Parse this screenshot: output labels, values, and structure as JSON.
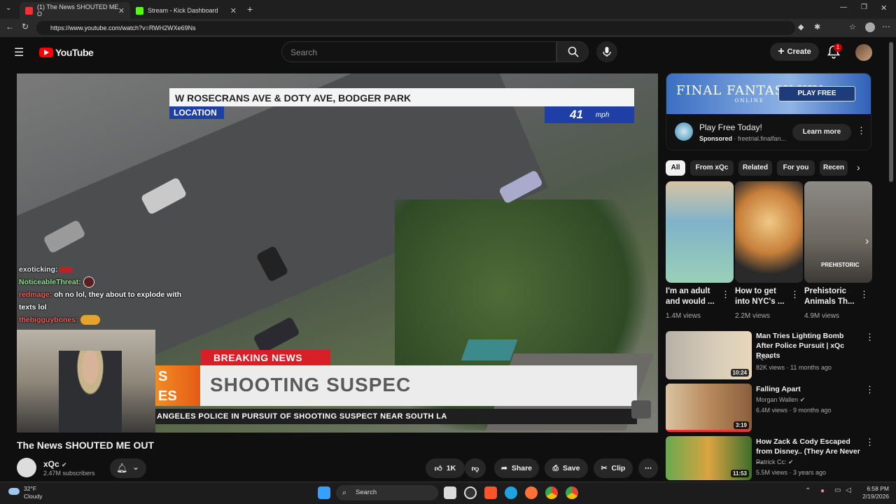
{
  "browser": {
    "tabs": [
      {
        "label": "(1) The News SHOUTED ME O"
      },
      {
        "label": "Stream - Kick Dashboard"
      }
    ],
    "url": "https://www.youtube.com/watch?v=RWH2WXe69Ns"
  },
  "header": {
    "logo_text": "YouTube",
    "search_placeholder": "Search",
    "create_label": "Create",
    "notification_count": "1"
  },
  "video": {
    "overlay": {
      "location_text": "W ROSECRANS AVE & DOTY AVE, BODGER PARK",
      "location_label": "LOCATION",
      "speed_value": "41",
      "speed_unit": "mph",
      "breaking_label": "BREAKING NEWS",
      "headline_side": "S\nES",
      "headline": "SHOOTING SUSPEC",
      "ticker": "ANGELES POLICE IN PURSUIT OF SHOOTING SUSPECT NEAR SOUTH LA"
    },
    "chat": [
      {
        "user": "exoticking:",
        "msg": ""
      },
      {
        "user": "NoticeableThreat:",
        "msg": ""
      },
      {
        "user": "redmage:",
        "msg": "oh no lol, they about to explode with texts lol"
      },
      {
        "user": "thebigguybones:",
        "msg": ""
      }
    ],
    "title": "The News SHOUTED ME OUT",
    "channel": "xQc",
    "subscribers": "2.47M subscribers",
    "likes": "1K",
    "share_label": "Share",
    "save_label": "Save",
    "clip_label": "Clip"
  },
  "ad": {
    "banner_logo": "FINAL FANTASY XIV",
    "banner_sub": "ONLINE",
    "banner_button": "PLAY FREE",
    "title": "Play Free Today!",
    "sponsored": "Sponsored",
    "domain": "· freetrial.finalfan...",
    "learn_more": "Learn more"
  },
  "chips": [
    "All",
    "From xQc",
    "Related",
    "For you",
    "Recen"
  ],
  "shorts": [
    {
      "title": "I'm an adult and would ...",
      "views": "1.4M views",
      "thumb_text": ""
    },
    {
      "title": "How to get into NYC's ...",
      "views": "2.2M views",
      "thumb_text": ""
    },
    {
      "title": "Prehistoric Animals Th...",
      "views": "4.9M views",
      "thumb_text": "PREHISTORIC"
    }
  ],
  "recommendations": [
    {
      "title": "Man Tries Lighting Bomb After Police Pursuit | xQc Reacts",
      "channel": "xQc",
      "meta": "82K views · 11 months ago",
      "duration": "10:24"
    },
    {
      "title": "Falling Apart",
      "channel": "Morgan Wallen",
      "meta": "6.4M views · 9 months ago",
      "duration": "3:19"
    },
    {
      "title": "How Zack & Cody Escaped from Disney.. (They Are Never ...",
      "channel": "Patrick Cc:",
      "meta": "5.5M views · 3 years ago",
      "duration": "11:53"
    }
  ],
  "taskbar": {
    "temp": "32°F",
    "condition": "Cloudy",
    "search_label": "Search",
    "time": "6:58 PM",
    "date": "2/19/2026"
  }
}
